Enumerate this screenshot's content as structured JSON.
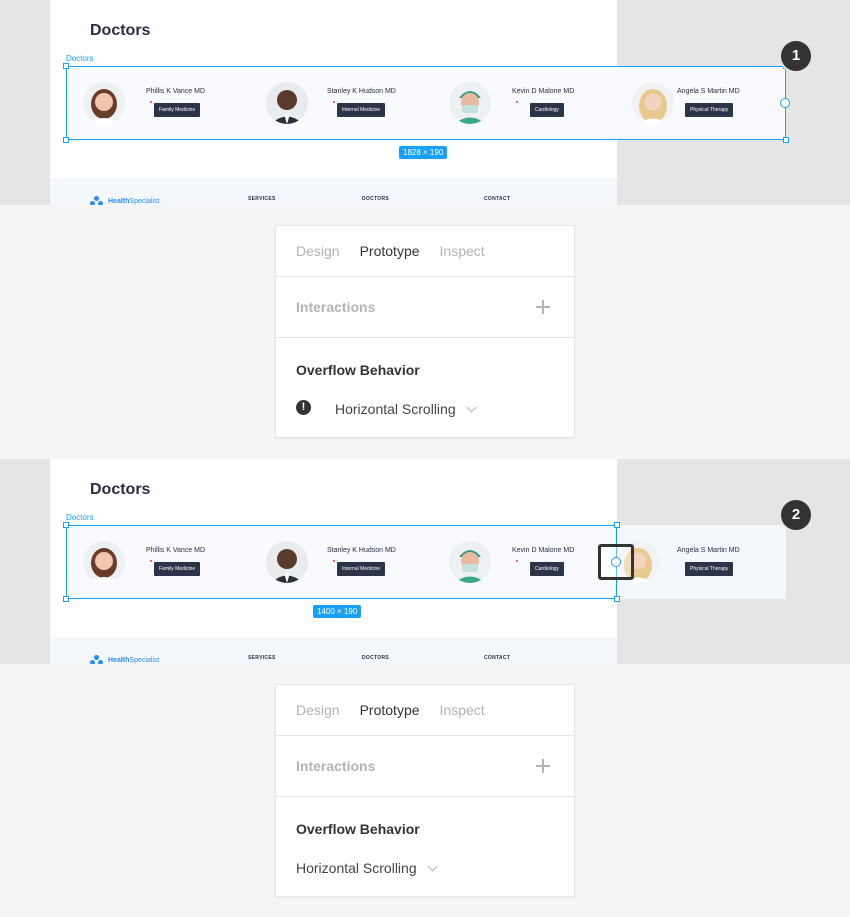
{
  "frame_title": "Doctors",
  "frame_layer_label": "Doctors",
  "doctors": [
    {
      "name": "Phillis K Vance MD",
      "specialty": "Family Medicine"
    },
    {
      "name": "Stanley K Hudson MD",
      "specialty": "Internal Medicine"
    },
    {
      "name": "Kevin D Malone MD",
      "specialty": "Cardiology"
    },
    {
      "name": "Angela S Martin MD",
      "specialty": "Physical Therapy"
    }
  ],
  "footer": {
    "logo_strong": "Health",
    "logo_light": "Specialist",
    "nav": [
      "SERVICES",
      "DOCTORS",
      "CONTACT"
    ]
  },
  "step1": {
    "badge": "1",
    "dimensions": "1828 × 190"
  },
  "step2": {
    "badge": "2",
    "dimensions": "1400 × 190"
  },
  "panel": {
    "tabs": [
      "Design",
      "Prototype",
      "Inspect"
    ],
    "active_tab": "Prototype",
    "interactions_label": "Interactions",
    "overflow_label": "Overflow Behavior",
    "overflow_value": "Horizontal Scrolling"
  },
  "colors": {
    "selection": "#18a0fb",
    "tag_bg": "#2b3448",
    "brand": "#2d8cf0"
  }
}
